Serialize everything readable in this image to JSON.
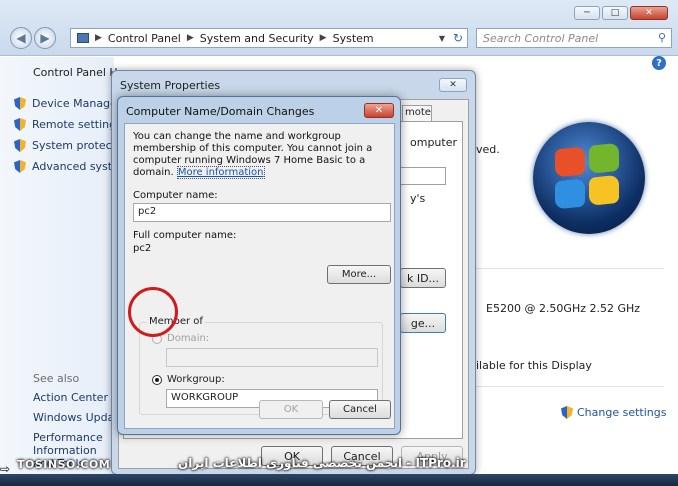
{
  "explorer": {
    "breadcrumb": [
      "Control Panel",
      "System and Security",
      "System"
    ],
    "search_placeholder": "Search Control Panel",
    "help": "?"
  },
  "left_pane": {
    "home": "Control Panel Home",
    "tasks": [
      "Device Manager",
      "Remote settings",
      "System protection",
      "Advanced system settings"
    ],
    "see_also_label": "See also",
    "see_also": [
      "Action Center",
      "Windows Update",
      "Performance Information and Tools"
    ]
  },
  "main": {
    "frag_reserved": "ved.",
    "processor_value": "E5200  @ 2.50GHz  2.52 GHz",
    "display_frag": "ilable for this Display",
    "change_settings": "Change settings"
  },
  "system_properties": {
    "title": "System Properties",
    "tab_frag": "mote",
    "frag_computer": "omputer",
    "frag_ys": "y's",
    "id_button_frag": "k ID...",
    "change_button_frag": "ge...",
    "ok": "OK",
    "cancel": "Cancel",
    "apply": "Apply"
  },
  "dialog": {
    "title": "Computer Name/Domain Changes",
    "intro": "You can change the name and workgroup membership of this computer. You cannot join a computer running Windows 7 Home Basic to a domain.",
    "more_info_link": "More information",
    "computer_name_label": "Computer name:",
    "computer_name_value": "pc2",
    "full_name_label": "Full computer name:",
    "full_name_value": "pc2",
    "more_button": "More...",
    "member_of_label": "Member of",
    "domain_label": "Domain:",
    "domain_value": "",
    "workgroup_label": "Workgroup:",
    "workgroup_value": "WORKGROUP",
    "ok": "OK",
    "cancel": "Cancel"
  },
  "watermark": {
    "left": "TOSINSO.COM",
    "right": "ITPro.ir - انجمن تخصصی فناوری اطلاعات ایران"
  },
  "colors": {
    "accent": "#1554b6",
    "annotation": "#d11c1c",
    "close_red": "#c7432e"
  }
}
